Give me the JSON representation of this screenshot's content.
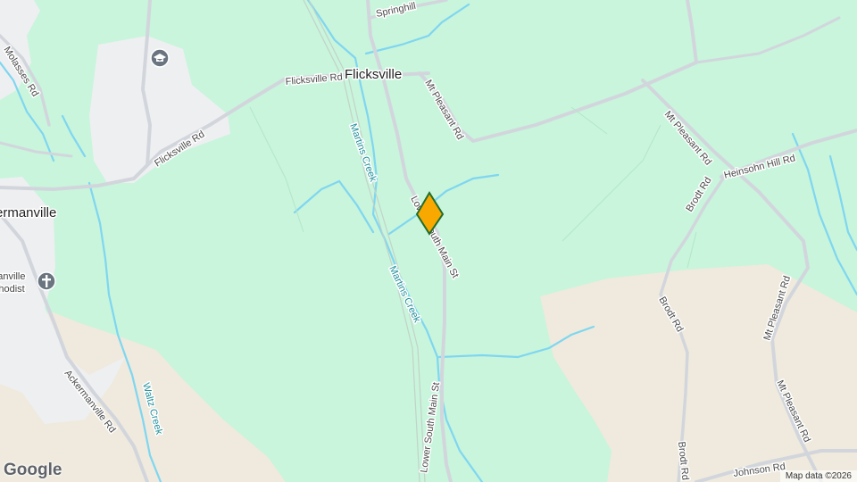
{
  "map": {
    "place_labels": {
      "flicksville": "Flicksville",
      "ackermanville": "Ackermanville"
    },
    "poi_labels": {
      "church_line1": "Ackermanville",
      "church_line2": "Methodist"
    },
    "road_labels": {
      "flicksville_rd_1": "Flicksville Rd",
      "flicksville_rd_2": "Flicksville Rd",
      "mt_pleasant_rd_1": "Mt Pleasant Rd",
      "mt_pleasant_rd_2": "Mt Pleasant Rd",
      "mt_pleasant_rd_3": "Mt Pleasant Rd",
      "mt_pleasant_rd_4": "Mt Pleasant Rd",
      "heinsohn_hill_rd": "Heinsohn Hill Rd",
      "brodt_rd_1": "Brodt Rd",
      "brodt_rd_2": "Brodt Rd",
      "brodt_rd_3": "Brodt Rd",
      "lower_south_main_st_1": "Lower South Main St",
      "lower_south_main_st_2": "Lower South Main St",
      "johnson_rd": "Johnson Rd",
      "ackermanville_rd": "Ackermanville Rd",
      "molasses_rd": "Molasses Rd",
      "springhill": "Springhill"
    },
    "water_labels": {
      "martins_creek_1": "Martins Creek",
      "martins_creek_2": "Martins Creek",
      "waltz_creek": "Waltz Creek"
    },
    "icons": {
      "school": "graduation-cap-icon",
      "church": "cross-icon",
      "marker": "diamond-marker-icon"
    },
    "colors": {
      "land": "#c8f5dc",
      "farmland": "#efeadd",
      "urban": "#eeeff1",
      "road": "#d2d6dc",
      "water": "#7fd6f0",
      "marker_fill": "#f9a800",
      "marker_stroke": "#1f6e2c"
    },
    "google_logo": "Google",
    "attribution": "Map data ©2026"
  }
}
